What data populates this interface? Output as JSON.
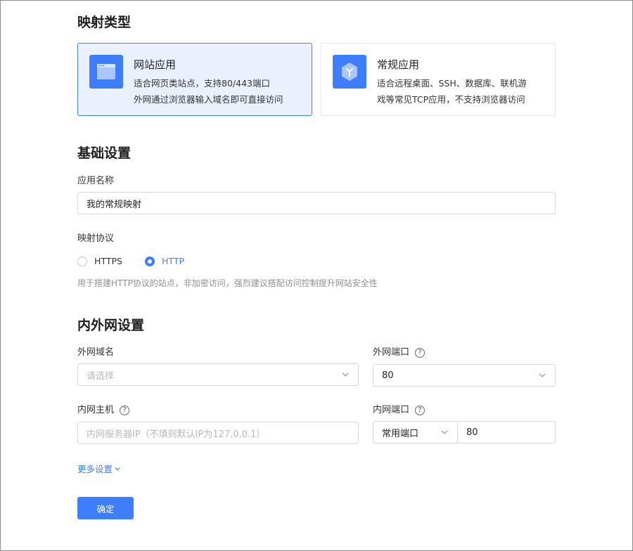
{
  "mapping_type": {
    "heading": "映射类型",
    "cards": [
      {
        "title": "网站应用",
        "desc_line1": "适合网页类站点，支持80/443端口",
        "desc_line2": "外网通过浏览器输入域名即可直接访问",
        "icon": "browser-window-icon",
        "selected": true
      },
      {
        "title": "常规应用",
        "desc_line1": "适合远程桌面、SSH、数据库、联机游",
        "desc_line2": "戏等常见TCP应用，不支持浏览器访问",
        "icon": "hexagon-app-icon",
        "selected": false
      }
    ]
  },
  "basic": {
    "heading": "基础设置",
    "app_name_label": "应用名称",
    "app_name_value": "我的常规映射",
    "protocol_label": "映射协议",
    "protocols": [
      {
        "label": "HTTPS",
        "checked": false
      },
      {
        "label": "HTTP",
        "checked": true
      }
    ],
    "protocol_hint": "用于搭建HTTP协议的站点，非加密访问，强烈建议搭配访问控制提升网站安全性"
  },
  "network": {
    "heading": "内外网设置",
    "ext_domain_label": "外网域名",
    "ext_domain_placeholder": "请选择",
    "ext_port_label": "外网端口",
    "ext_port_value": "80",
    "int_host_label": "内网主机",
    "int_host_placeholder": "内网服务器IP（不填则默认IP为127.0.0.1）",
    "int_port_label": "内网端口",
    "int_port_type": "常用端口",
    "int_port_value": "80",
    "help_glyph": "?"
  },
  "more_settings": "更多设置",
  "confirm": "确定",
  "colors": {
    "accent": "#3d7eff",
    "selected_bg": "#eaf1fd",
    "border": "#d4d7dc"
  }
}
